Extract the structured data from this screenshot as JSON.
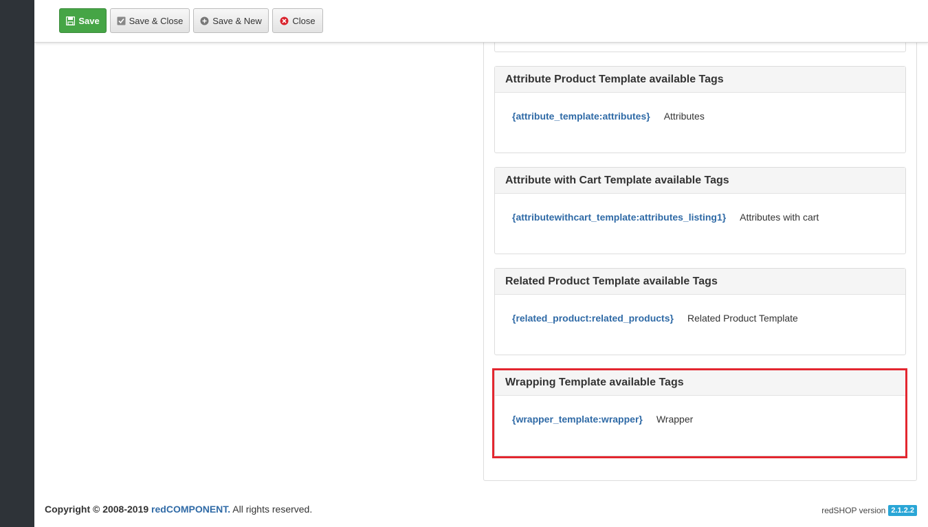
{
  "toolbar": {
    "save_label": "Save",
    "save_close_label": "Save & Close",
    "save_new_label": "Save & New",
    "close_label": "Close"
  },
  "cards": [
    {
      "title": "Attribute Product Template available Tags",
      "tag": "{attribute_template:attributes}",
      "description": "Attributes"
    },
    {
      "title": "Attribute with Cart Template available Tags",
      "tag": "{attributewithcart_template:attributes_listing1}",
      "description": "Attributes with cart"
    },
    {
      "title": "Related Product Template available Tags",
      "tag": "{related_product:related_products}",
      "description": "Related Product Template"
    },
    {
      "title": "Wrapping Template available Tags",
      "tag": "{wrapper_template:wrapper}",
      "description": "Wrapper"
    }
  ],
  "footer": {
    "copyright": "Copyright © 2008-2019",
    "brand": "redCOMPONENT.",
    "rights": "All rights reserved.",
    "version_label": "redSHOP version",
    "version": "2.1.2.2"
  },
  "colors": {
    "save_green": "#46a546",
    "link_blue": "#2f6aa6",
    "highlight_red": "#e3262f",
    "version_badge": "#2aa6d6"
  }
}
